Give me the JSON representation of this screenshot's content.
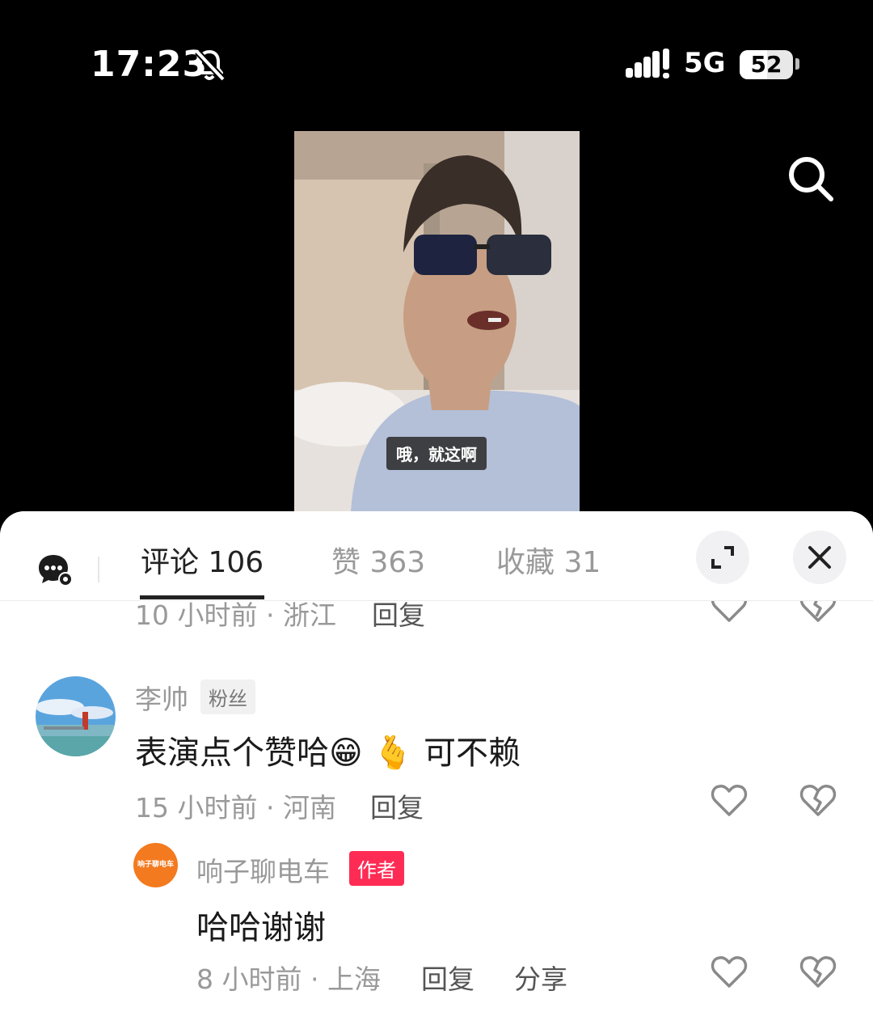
{
  "status_bar": {
    "time": "17:23",
    "network": "5G",
    "battery": "52",
    "battery_level": 0.52
  },
  "video": {
    "subtitle": "哦，就这啊"
  },
  "tabs": [
    {
      "label": "评论 106"
    },
    {
      "label": "赞 363"
    },
    {
      "label": "收藏 31"
    }
  ],
  "comments": [
    {
      "meta": "10 小时前 · 浙江",
      "reply": "回复"
    },
    {
      "user": "李帅",
      "badge": "粉丝",
      "text": "表演点个赞哈",
      "emoji1": "😁",
      "emoji2": "🫰",
      "text_tail": "可不赖",
      "meta": "15 小时前 · 河南",
      "reply": "回复"
    },
    {
      "user": "响子聊电车",
      "badge": "作者",
      "avatar_text": "响子聊电车",
      "text": "哈哈谢谢",
      "meta": "8 小时前 · 上海",
      "reply": "回复",
      "share": "分享"
    }
  ]
}
